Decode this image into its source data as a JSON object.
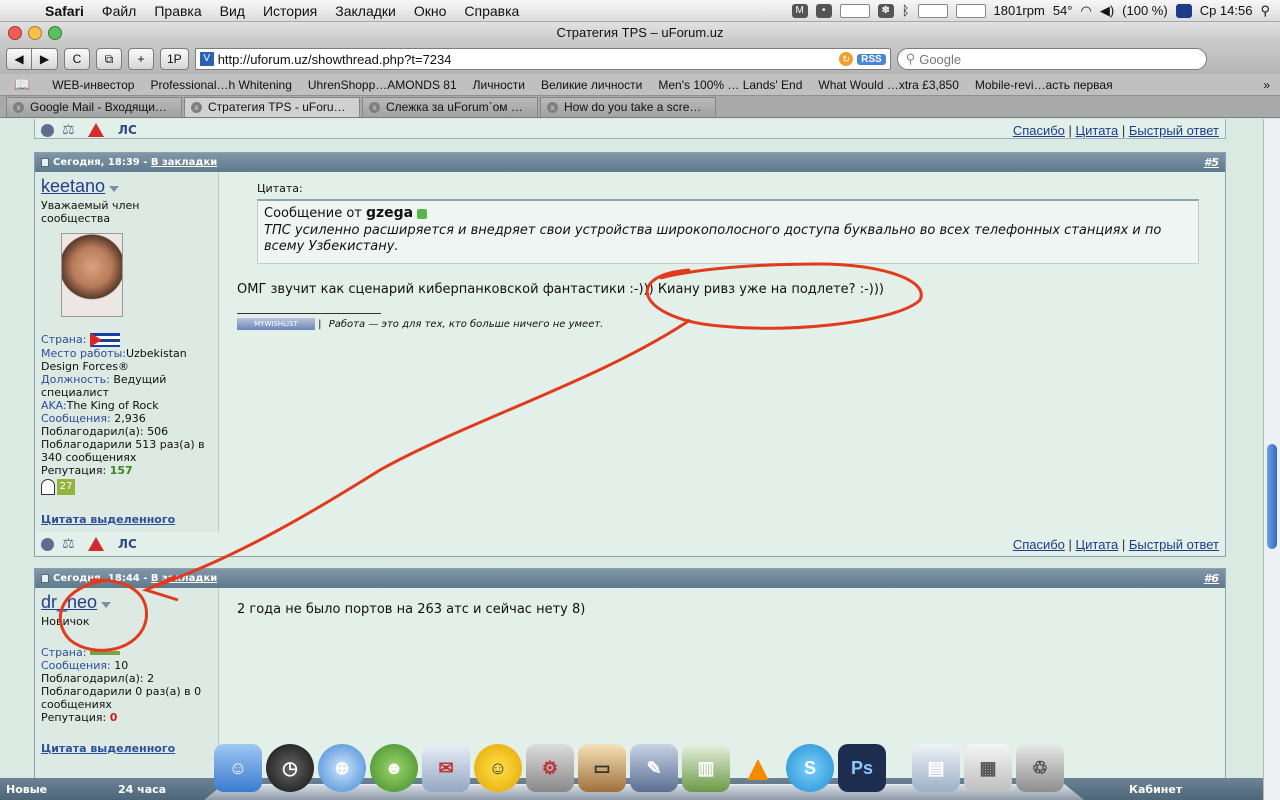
{
  "menubar": {
    "app": "Safari",
    "items": [
      "Файл",
      "Правка",
      "Вид",
      "История",
      "Закладки",
      "Окно",
      "Справка"
    ],
    "rpm": "1801rpm",
    "temp": "54°",
    "battery": "(100 %)",
    "clock": "Ср 14:56"
  },
  "window": {
    "title": "Стратегия TPS – uForum.uz"
  },
  "toolbar": {
    "url": "http://uforum.uz/showthread.php?t=7234",
    "rss_label": "RSS",
    "search_placeholder": "Google",
    "btn_back": "◀",
    "btn_forward": "▶",
    "btn_reload": "C",
    "btn_snap": "⧉",
    "btn_add": "+",
    "btn_1p": "1P"
  },
  "bookmarks": [
    "WEB-инвестор",
    "Professional…h Whitening",
    "UhrenShopp…AMONDS 81",
    "Личности",
    "Великие личности",
    "Men's 100% … Lands' End",
    "What Would …xtra £3,850",
    "Mobile-revi…асть первая"
  ],
  "tabs": [
    "Google Mail - Входящи…",
    "Стратегия TPS - uForu…",
    "Слежка за uForum`ом …",
    "How do you take a scre…"
  ],
  "actions": {
    "ls": "ЛС",
    "thanks": "Спасибо",
    "quote": "Цитата",
    "quick_reply": "Быстрый ответ"
  },
  "posts": [
    {
      "date": "Сегодня, 18:39",
      "bookmark": "В закладки",
      "number": "#5",
      "username": "keetano",
      "user_title": "Уважаемый член сообщества",
      "country_label": "Страна:",
      "work_label": "Место работы:",
      "work_value": "Uzbekistan Design Forces®",
      "position_label": "Должность:",
      "position_value": "Ведущий специалист",
      "aka_label": "AKA:",
      "aka_value": "The King of Rock",
      "messages_label": "Сообщения:",
      "messages_value": "2,936",
      "thanked_text": "Поблагодарил(а): 506",
      "was_thanked_text": "Поблагодарили 513 раз(а) в 340 сообщениях",
      "rep_label": "Репутация:",
      "rep_value": "157",
      "badge_num": "27",
      "quote_selected": "Цитата выделенного",
      "quote_label": "Цитата:",
      "quote_from_prefix": "Сообщение от",
      "quote_author": "gzega",
      "quote_text": "ТПС усиленно расширяется и внедряет свои устройства широкополосного доступа буквально во всех телефонных станциях и по всему Узбекистану.",
      "message": "ОМГ звучит как сценарий киберпанковской фантастики :-))) Киану ривз уже на подлете? :-)))",
      "sig_button": "MYWISHLIST",
      "sig_text": "Работа — это для тех, кто больше ничего не умеет."
    },
    {
      "date": "Сегодня, 18:44",
      "bookmark": "В закладки",
      "number": "#6",
      "username": "dr_neo",
      "user_title": "Новичок",
      "country_label": "Страна:",
      "messages_label": "Сообщения:",
      "messages_value": "10",
      "thanked_text": "Поблагодарил(а): 2",
      "was_thanked_text": "Поблагодарили 0 раз(а) в 0 сообщениях",
      "rep_label": "Репутация:",
      "rep_value": "0",
      "quote_selected": "Цитата выделенного",
      "message": "2 года не было портов на 263 атс и сейчас нету 8)"
    }
  ],
  "footer": {
    "new": "Новые",
    "day": "24 часа",
    "cabinet": "Кабинет"
  },
  "dock": [
    "Finder",
    "Dashboard",
    "Safari",
    "Adium",
    "Mail",
    "iChat",
    "Automator",
    "Keynote",
    "Xcode",
    "Numbers",
    "VLC",
    "Skype",
    "Photoshop",
    "Preview",
    "Documents",
    "Trash"
  ],
  "colors": {
    "annotation": "#e23a1c",
    "post_header": "#6c8598",
    "link": "#1e3d8a"
  }
}
